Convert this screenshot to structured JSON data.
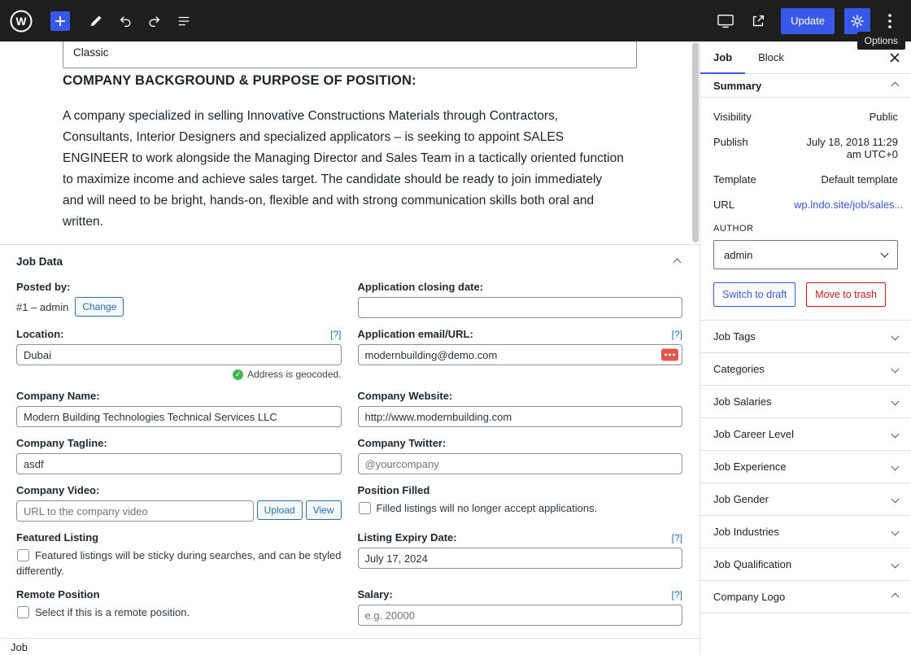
{
  "colors": {
    "accent": "#3858e9",
    "link": "#2271b1",
    "success": "#46b450",
    "destructive": "#cc1818",
    "topbar": "#1e1e1e",
    "border": "#e0e0e0",
    "input-border": "#8c8f94",
    "autofill-badge": "#e2574c"
  },
  "icons": {
    "topbar": [
      "wordpress-logo",
      "block-inserter-icon",
      "tools-icon",
      "undo-icon",
      "redo-icon",
      "document-overview-icon",
      "preview-icon",
      "view-post-icon",
      "settings-icon",
      "options-icon"
    ],
    "other": [
      "close-icon",
      "chevron-up-icon",
      "chevron-down-icon",
      "check-icon",
      "autofill-icon"
    ]
  },
  "topbar": {
    "update_label": "Update",
    "options_tooltip": "Options"
  },
  "editor": {
    "classic_label": "Classic",
    "heading": "COMPANY BACKGROUND & PURPOSE OF POSITION:",
    "paragraph": "A company specialized in selling Innovative Constructions Materials through Contractors, Consultants, Interior Designers and specialized applicators – is seeking to appoint SALES ENGINEER to work alongside the Managing Director and Sales Team in a tactically oriented function to maximize income and achieve sales target. The candidate should be ready to join immediately and will need to be bright, hands-on, flexible and with strong communication skills both oral and written."
  },
  "job_data": {
    "title": "Job Data",
    "posted_by": {
      "label": "Posted by:",
      "value": "#1 – admin",
      "change_label": "Change"
    },
    "closing_date": {
      "label": "Application closing date:",
      "value": ""
    },
    "location": {
      "label": "Location:",
      "help": "[?]",
      "value": "Dubai",
      "geocoded_text": "Address is geocoded."
    },
    "email": {
      "label": "Application email/URL:",
      "help": "[?]",
      "value": "modernbuilding@demo.com"
    },
    "company_name": {
      "label": "Company Name:",
      "value": "Modern Building Technologies Technical Services LLC"
    },
    "company_website": {
      "label": "Company Website:",
      "value": "http://www.modernbuilding.com"
    },
    "company_tagline": {
      "label": "Company Tagline:",
      "value": "asdf"
    },
    "company_twitter": {
      "label": "Company Twitter:",
      "placeholder": "@yourcompany"
    },
    "company_video": {
      "label": "Company Video:",
      "placeholder": "URL to the company video",
      "upload_label": "Upload",
      "view_label": "View"
    },
    "position_filled": {
      "label": "Position Filled",
      "checkbox_text": "Filled listings will no longer accept applications.",
      "checked": false
    },
    "featured": {
      "label": "Featured Listing",
      "checkbox_text": "Featured listings will be sticky during searches, and can be styled differently.",
      "checked": false
    },
    "expiry": {
      "label": "Listing Expiry Date:",
      "help": "[?]",
      "value": "July 17, 2024"
    },
    "remote": {
      "label": "Remote Position",
      "checkbox_text": "Select if this is a remote position.",
      "checked": false
    },
    "salary": {
      "label": "Salary:",
      "help": "[?]",
      "placeholder": "e.g. 20000"
    }
  },
  "sidebar": {
    "tabs": [
      {
        "label": "Job",
        "active": true
      },
      {
        "label": "Block",
        "active": false
      }
    ],
    "summary": {
      "title": "Summary",
      "rows": [
        {
          "label": "Visibility",
          "value": "Public"
        },
        {
          "label": "Publish",
          "value": "July 18, 2018 11:29 am UTC+0"
        },
        {
          "label": "Template",
          "value": "Default template"
        },
        {
          "label": "URL",
          "value": "wp.lndo.site/job/sales..."
        }
      ],
      "author_label": "AUTHOR",
      "author_value": "admin",
      "switch_to_draft_label": "Switch to draft",
      "move_to_trash_label": "Move to trash"
    },
    "sections": [
      {
        "label": "Job Tags",
        "expanded": false
      },
      {
        "label": "Categories",
        "expanded": false
      },
      {
        "label": "Job Salaries",
        "expanded": false
      },
      {
        "label": "Job Career Level",
        "expanded": false
      },
      {
        "label": "Job Experience",
        "expanded": false
      },
      {
        "label": "Job Gender",
        "expanded": false
      },
      {
        "label": "Job Industries",
        "expanded": false
      },
      {
        "label": "Job Qualification",
        "expanded": false
      },
      {
        "label": "Company Logo",
        "expanded": true
      }
    ]
  },
  "footer": {
    "breadcrumb": "Job"
  }
}
